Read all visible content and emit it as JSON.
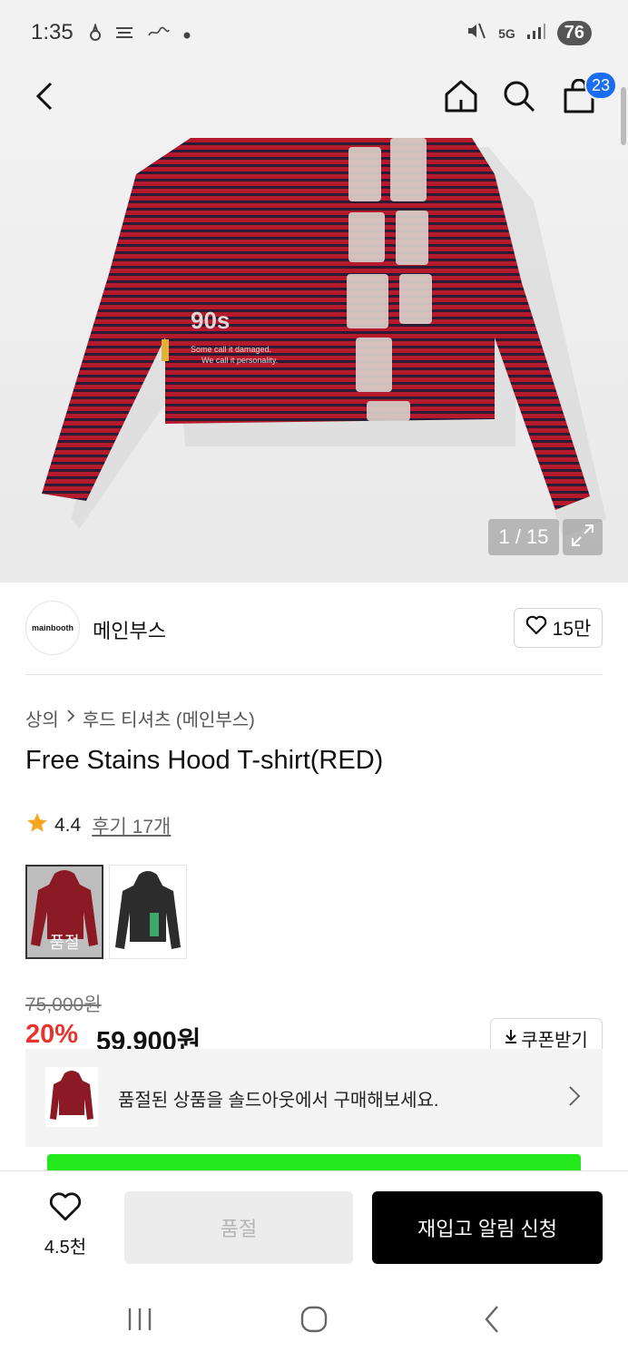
{
  "status_bar": {
    "time": "1:35",
    "network": "5G",
    "battery": "76"
  },
  "header": {
    "cart_count": "23"
  },
  "hero": {
    "print_text": "90s",
    "print_subtext_1": "Some call it damaged.",
    "print_subtext_2": "We call it personality.",
    "counter": "1 / 15"
  },
  "brand": {
    "logo_text": "mainbooth",
    "name": "메인부스",
    "follow_count": "15만"
  },
  "breadcrumb": {
    "category": "상의",
    "subcategory": "후드 티셔츠 (메인부스)"
  },
  "product": {
    "title": "Free Stains Hood T-shirt(RED)",
    "rating": "4.4",
    "reviews": "후기 17개",
    "swatch_soldout": "품절",
    "original_price": "75,000원",
    "discount": "20%",
    "sale_price": "59,900원",
    "coupon_label": "쿠폰받기"
  },
  "soldout_banner": {
    "text": "품절된 상품을 솔드아웃에서 구매해보세요."
  },
  "bottom_bar": {
    "like_count": "4.5천",
    "soldout_label": "품절",
    "restock_label": "재입고 알림 신청"
  },
  "colors": {
    "accent_blue": "#1a6cf0",
    "discount_red": "#e8342c",
    "shirt_red": "#b0162a",
    "shirt_stripe": "#2a1b3a"
  }
}
